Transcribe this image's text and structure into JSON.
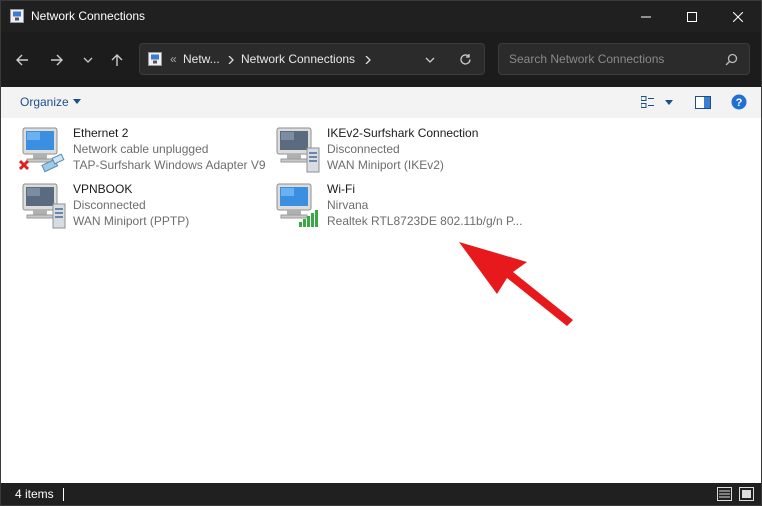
{
  "window": {
    "title": "Network Connections"
  },
  "address_bar": {
    "overflow": "«",
    "crumb_1": "Netw...",
    "crumb_2": "Network Connections"
  },
  "search": {
    "placeholder": "Search Network Connections"
  },
  "toolbar": {
    "organize_label": "Organize"
  },
  "connections": [
    {
      "name": "Ethernet 2",
      "status": "Network cable unplugged",
      "device": "TAP-Surfshark Windows Adapter V9",
      "icon": "ethernet-disconnected-icon"
    },
    {
      "name": "IKEv2-Surfshark Connection",
      "status": "Disconnected",
      "device": "WAN Miniport (IKEv2)",
      "icon": "vpn-connection-icon"
    },
    {
      "name": "VPNBOOK",
      "status": "Disconnected",
      "device": "WAN Miniport (PPTP)",
      "icon": "vpn-connection-icon"
    },
    {
      "name": "Wi-Fi",
      "status": "Nirvana",
      "device": "Realtek RTL8723DE 802.11b/g/n P...",
      "icon": "wifi-connected-icon"
    }
  ],
  "status_bar": {
    "item_count": "4 items"
  },
  "colors": {
    "annotation_arrow": "#e8191c",
    "link_blue": "#1a4f8a",
    "wifi_green": "#3aa845"
  }
}
